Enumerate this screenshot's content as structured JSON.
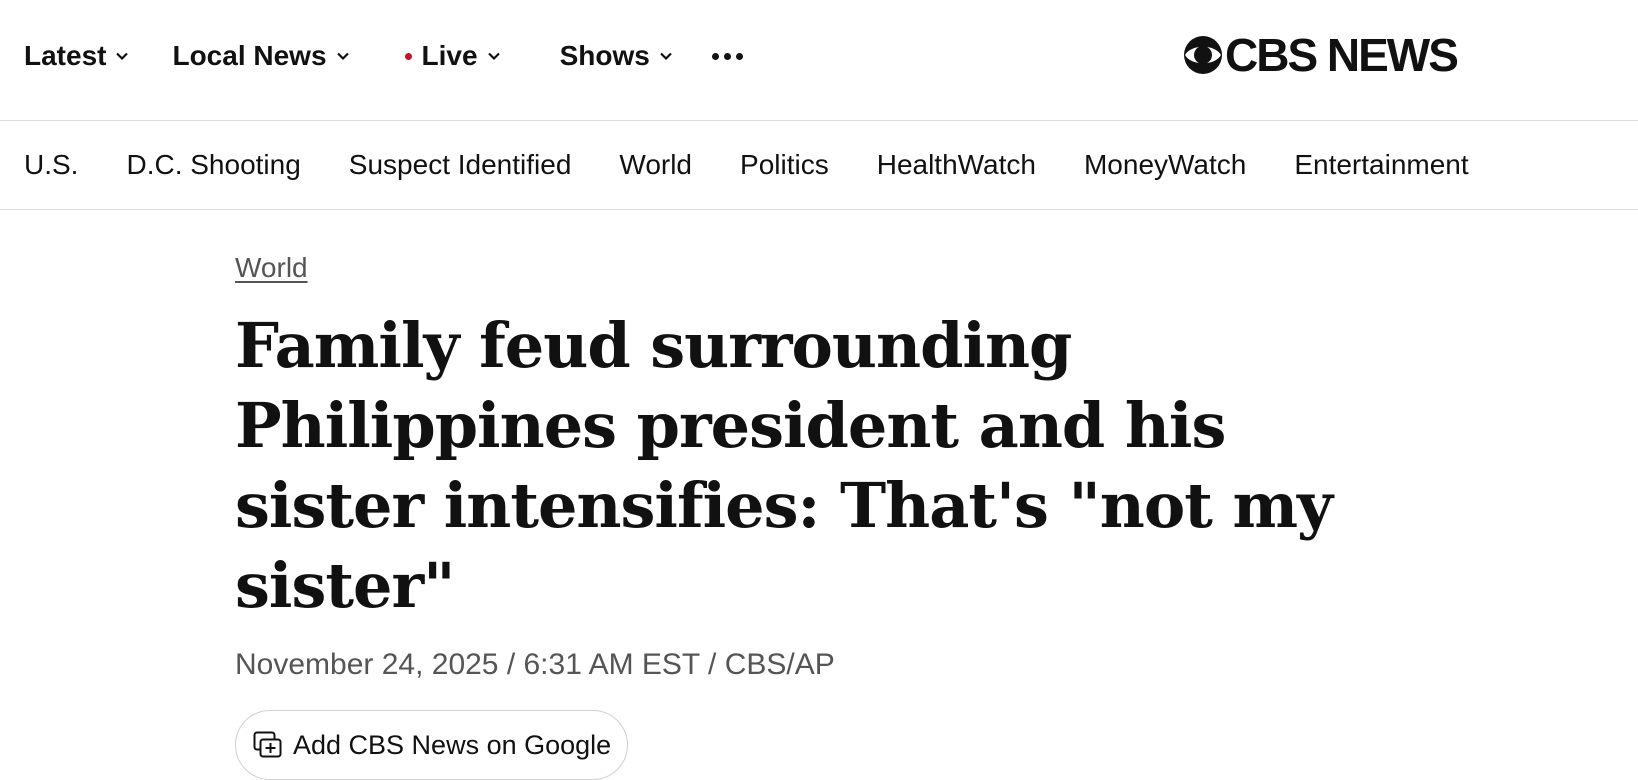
{
  "top_nav": {
    "items": [
      {
        "label": "Latest",
        "has_dropdown": true
      },
      {
        "label": "Local News",
        "has_dropdown": true
      },
      {
        "label": "Live",
        "has_dropdown": true,
        "live_indicator": true
      },
      {
        "label": "Shows",
        "has_dropdown": true
      }
    ],
    "more_icon": "more-horizontal-icon"
  },
  "logo": {
    "text": "CBS NEWS",
    "icon": "cbs-eye-icon"
  },
  "sub_nav": {
    "items": [
      "U.S.",
      "D.C. Shooting",
      "Suspect Identified",
      "World",
      "Politics",
      "HealthWatch",
      "MoneyWatch",
      "Entertainment"
    ]
  },
  "article": {
    "section": "World",
    "headline": "Family feud surrounding Philippines president and his sister intensifies: That's \"not my sister\"",
    "byline": "November 24, 2025 / 6:31 AM EST / CBS/AP",
    "google_button_label": "Add CBS News on Google",
    "google_button_icon": "add-source-icon"
  },
  "colors": {
    "live_dot": "#c8102e",
    "text": "#111111",
    "muted": "#555555",
    "divider": "#dcdcdc"
  }
}
